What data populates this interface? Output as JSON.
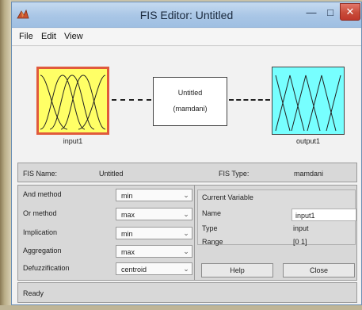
{
  "window": {
    "title": "FIS Editor: Untitled"
  },
  "menu": {
    "items": [
      "File",
      "Edit",
      "View"
    ]
  },
  "diagram": {
    "input_label": "input1",
    "output_label": "output1",
    "system_name": "Untitled",
    "system_type": "(mamdani)"
  },
  "info": {
    "fis_name_label": "FIS Name:",
    "fis_name_value": "Untitled",
    "fis_type_label": "FIS Type:",
    "fis_type_value": "mamdani"
  },
  "methods": [
    {
      "label": "And method",
      "value": "min"
    },
    {
      "label": "Or method",
      "value": "max"
    },
    {
      "label": "Implication",
      "value": "min"
    },
    {
      "label": "Aggregation",
      "value": "max"
    },
    {
      "label": "Defuzzification",
      "value": "centroid"
    }
  ],
  "current_variable": {
    "title": "Current Variable",
    "name_label": "Name",
    "name_value": "input1",
    "type_label": "Type",
    "type_value": "input",
    "range_label": "Range",
    "range_value": "[0 1]"
  },
  "buttons": {
    "help": "Help",
    "close": "Close"
  },
  "status": {
    "text": "Ready"
  },
  "colors": {
    "input_block": "#ffff66",
    "input_border": "#e05a3c",
    "output_block": "#77ffff",
    "close_button": "#c84c3a"
  },
  "icons": {
    "app": "matlab-icon",
    "minimize": "minimize-icon",
    "maximize": "maximize-icon",
    "close": "close-icon",
    "dropdown": "chevron-down-icon"
  }
}
